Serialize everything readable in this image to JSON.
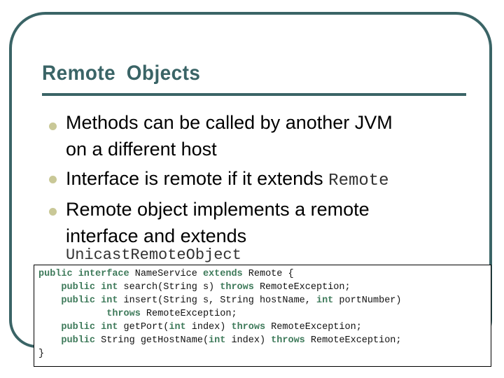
{
  "slide": {
    "title": "Remote  Objects",
    "bullets": [
      {
        "text": "Methods can be called by another JVM on a different host",
        "lines": [
          "Methods can be called by another JVM",
          "on a different host"
        ]
      },
      {
        "text": "Interface is remote if it extends ",
        "code": "Remote"
      },
      {
        "text": "Remote object implements a remote interface and extends",
        "lines": [
          "Remote object implements a remote",
          "interface and extends"
        ],
        "code": "UnicastRemoteObject"
      }
    ],
    "code_lines": [
      [
        {
          "kw": "public interface"
        },
        {
          "t": " NameService "
        },
        {
          "kw": "extends"
        },
        {
          "t": " Remote {"
        }
      ],
      [
        {
          "t": "    "
        },
        {
          "kw": "public int"
        },
        {
          "t": " search(String s) "
        },
        {
          "kw": "throws"
        },
        {
          "t": " RemoteException;"
        }
      ],
      [
        {
          "t": "    "
        },
        {
          "kw": "public int"
        },
        {
          "t": " insert(String s, String hostName, "
        },
        {
          "kw": "int"
        },
        {
          "t": " portNumber)"
        }
      ],
      [
        {
          "t": "            "
        },
        {
          "kw": "throws"
        },
        {
          "t": " RemoteException;"
        }
      ],
      [
        {
          "t": "    "
        },
        {
          "kw": "public int"
        },
        {
          "t": " getPort("
        },
        {
          "kw": "int"
        },
        {
          "t": " index) "
        },
        {
          "kw": "throws"
        },
        {
          "t": " RemoteException;"
        }
      ],
      [
        {
          "t": "    "
        },
        {
          "kw": "public"
        },
        {
          "t": " String getHostName("
        },
        {
          "kw": "int"
        },
        {
          "t": " index) "
        },
        {
          "kw": "throws"
        },
        {
          "t": " RemoteException;"
        }
      ],
      [
        {
          "t": "}"
        }
      ]
    ],
    "colors": {
      "frame": "#3a6466",
      "bullet": "#c9c897",
      "keyword": "#3e7a5a"
    }
  }
}
